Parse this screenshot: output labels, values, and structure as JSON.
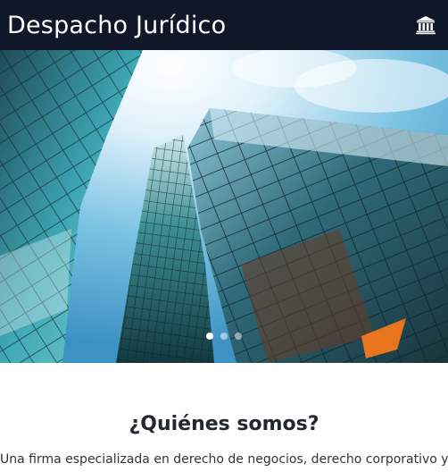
{
  "header": {
    "brand": "Despacho Jurídico",
    "icon": "bank-icon"
  },
  "carousel": {
    "slides": 3,
    "active_index": 0,
    "image": "glass-skyscrapers-photo"
  },
  "about": {
    "title": "¿Quiénes somos?",
    "text": "Una firma especializada en derecho de negocios, derecho corporativo y"
  },
  "colors": {
    "topbar": "#0f1729",
    "text": "#222831"
  }
}
